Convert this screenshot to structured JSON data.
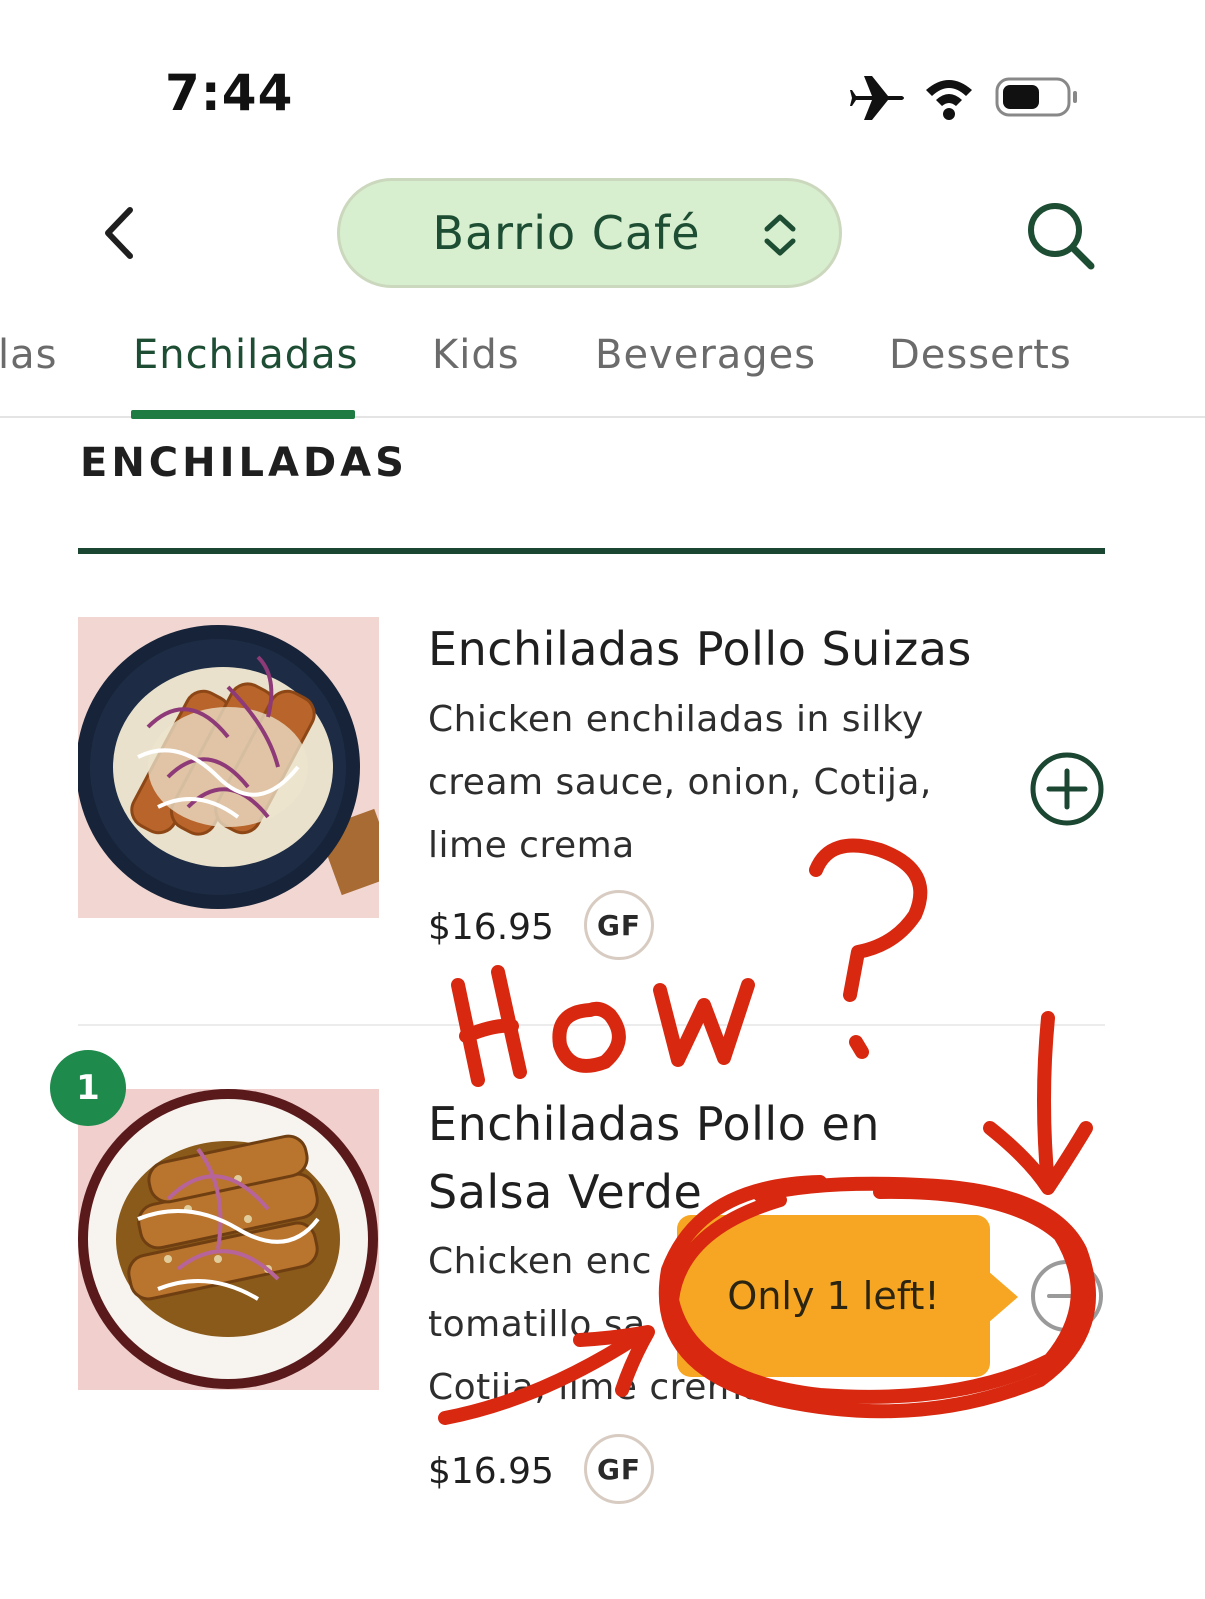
{
  "status_bar": {
    "time": "7:44",
    "icons": [
      "airplane-icon",
      "wifi-icon",
      "battery-icon"
    ]
  },
  "header": {
    "back_icon": "chevron-left-icon",
    "restaurant_name": "Barrio Café",
    "selector_icon": "chevron-up-down-icon",
    "search_icon": "search-icon"
  },
  "tabs": [
    {
      "label": "las",
      "active": false
    },
    {
      "label": "Enchiladas",
      "active": true
    },
    {
      "label": "Kids",
      "active": false
    },
    {
      "label": "Beverages",
      "active": false
    },
    {
      "label": "Desserts",
      "active": false
    }
  ],
  "section": {
    "title": "ENCHILADAS"
  },
  "items": [
    {
      "name": "Enchiladas Pollo Suizas",
      "description": "Chicken enchiladas in silky cream sauce, onion, Cotija, lime crema",
      "price": "$16.95",
      "badge": "GF",
      "action_icon": "plus-circle-icon"
    },
    {
      "name": "Enchiladas Pollo en Salsa Verde",
      "description_visible": [
        "Chicken enc",
        "tomatillo sa",
        "Cotija, lime crema"
      ],
      "price": "$16.95",
      "badge": "GF",
      "quantity": "1",
      "action_icon": "minus-circle-icon",
      "tooltip": "Only 1 left!"
    }
  ],
  "annotation": {
    "text": "How?",
    "color": "#d8280f"
  },
  "colors": {
    "brand_green": "#1d4d33",
    "tab_indicator": "#1e7c43",
    "pill_bg": "#d7efcf",
    "tooltip_bg": "#f6a623",
    "qty_badge": "#1e8a4c"
  }
}
